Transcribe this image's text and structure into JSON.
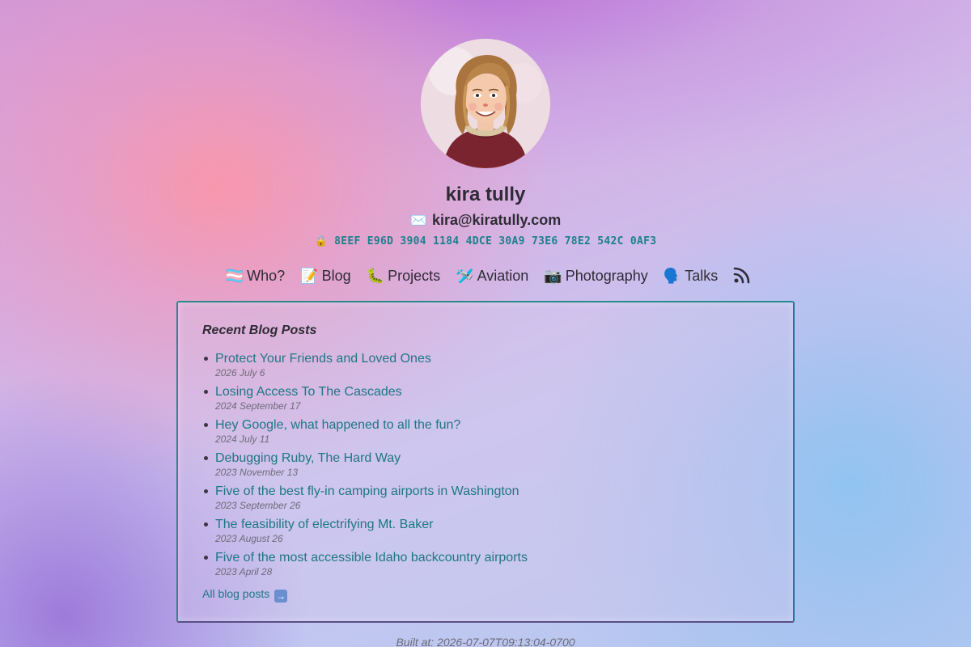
{
  "profile": {
    "name": "kira tully",
    "email_icon": "✉️",
    "email": "kira@kiratully.com",
    "lock_icon": "🔒",
    "key": "8EEF E96D 3904 1184 4DCE 30A9 73E6 78E2 542C 0AF3",
    "avatar": "avatar-illustration"
  },
  "nav": {
    "items": [
      {
        "icon": "🏳️‍⚧️",
        "label": "Who?"
      },
      {
        "icon": "📝",
        "label": "Blog"
      },
      {
        "icon": "🐛",
        "label": "Projects"
      },
      {
        "icon": "🛩️",
        "label": "Aviation"
      },
      {
        "icon": "📷",
        "label": "Photography"
      },
      {
        "icon": "🗣️",
        "label": "Talks"
      }
    ],
    "rss_icon": "rss-icon"
  },
  "recent": {
    "title": "Recent Blog Posts",
    "posts": [
      {
        "title": "Protect Your Friends and Loved Ones",
        "date": "2026 July 6"
      },
      {
        "title": "Losing Access To The Cascades",
        "date": "2024 September 17"
      },
      {
        "title": "Hey Google, what happened to all the fun?",
        "date": "2024 July 11"
      },
      {
        "title": "Debugging Ruby, The Hard Way",
        "date": "2023 November 13"
      },
      {
        "title": "Five of the best fly-in camping airports in Washington",
        "date": "2023 September 26"
      },
      {
        "title": "The feasibility of electrifying Mt. Baker",
        "date": "2023 August 26"
      },
      {
        "title": "Five of the most accessible Idaho backcountry airports",
        "date": "2023 April 28"
      }
    ],
    "all_label": "All blog posts",
    "all_icon": "➡️"
  },
  "footer": {
    "built": "Built at: 2026-07-07T09:13:04-0700"
  },
  "colors": {
    "link": "#1e7684",
    "key": "#1d7f8c",
    "card_border": "#3b7f8f"
  }
}
